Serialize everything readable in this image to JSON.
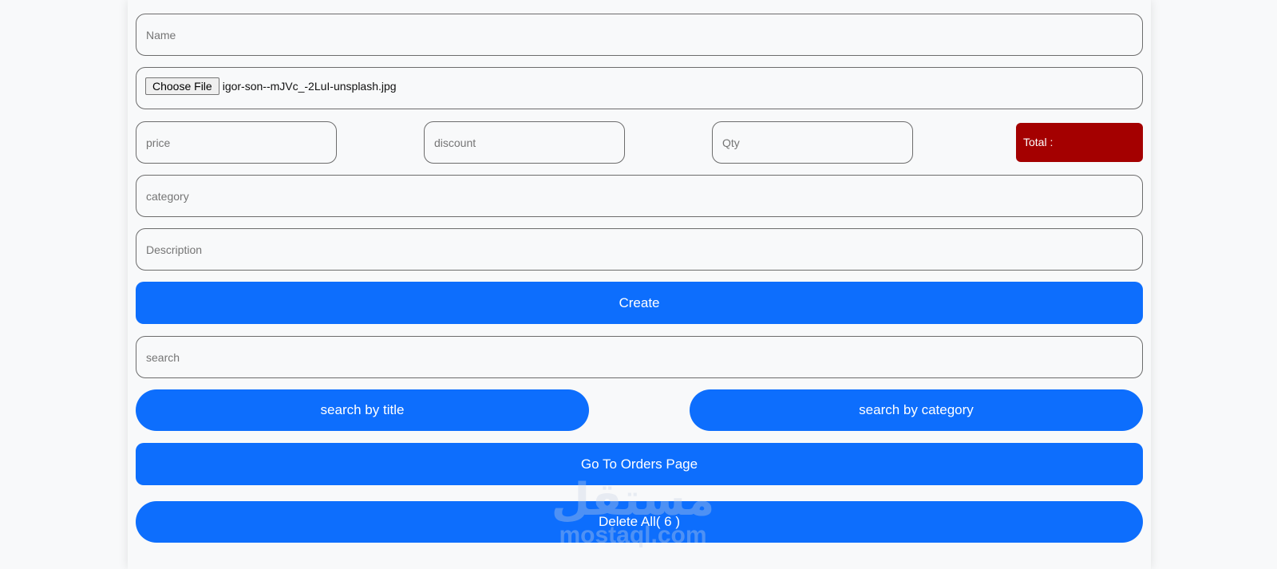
{
  "form": {
    "name_placeholder": "Name",
    "file_button_label": "Choose File",
    "file_name": "igor-son--mJVc_-2LuI-unsplash.jpg",
    "price_placeholder": "price",
    "discount_placeholder": "discount",
    "qty_placeholder": "Qty",
    "total_label": "Total :",
    "category_placeholder": "category",
    "description_placeholder": "Description",
    "create_label": "Create"
  },
  "search": {
    "placeholder": "search",
    "by_title_label": "search by title",
    "by_category_label": "search by category"
  },
  "actions": {
    "orders_label": "Go To Orders Page",
    "delete_all_label": "Delete All( 6 )"
  },
  "watermark": {
    "arabic": "مستقل",
    "latin": "mostaql.com"
  },
  "colors": {
    "primary": "#0d6efd",
    "total_bg": "#a40000",
    "background": "#f8f9fa"
  }
}
